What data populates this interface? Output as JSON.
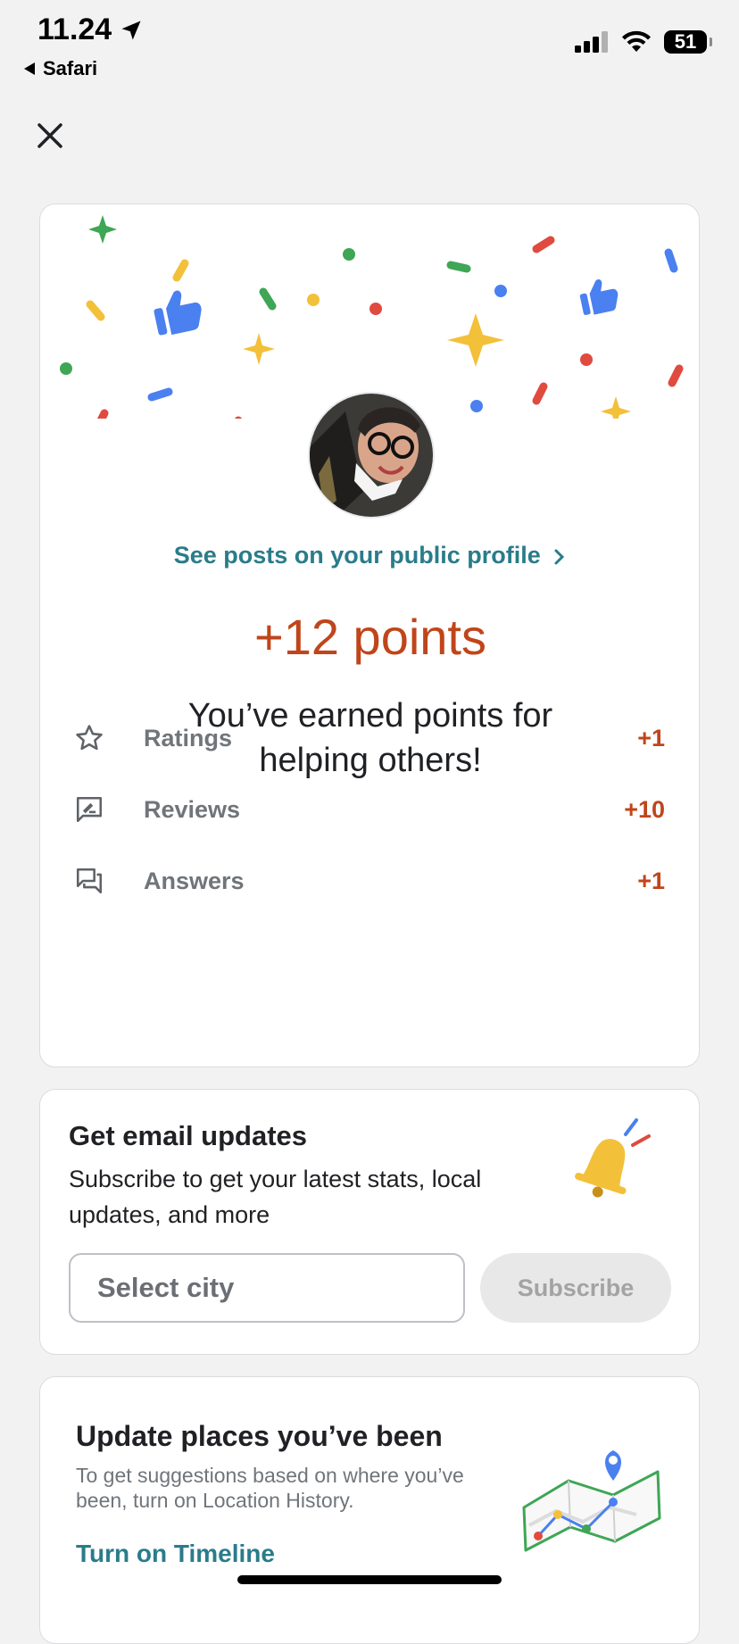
{
  "status_bar": {
    "time": "11.24",
    "back_label": "Safari",
    "battery": "51"
  },
  "points_card": {
    "profile_link": "See posts on your public profile",
    "points_total": "+12 points",
    "earned_message": "You’ve earned points for helping others!",
    "breakdown": [
      {
        "icon": "star-icon",
        "label": "Ratings",
        "points": "+1"
      },
      {
        "icon": "review-icon",
        "label": "Reviews",
        "points": "+10"
      },
      {
        "icon": "answers-icon",
        "label": "Answers",
        "points": "+1"
      }
    ]
  },
  "email_card": {
    "title": "Get email updates",
    "description": "Subscribe to get your latest stats, local updates, and more",
    "city_placeholder": "Select city",
    "subscribe_label": "Subscribe"
  },
  "places_card": {
    "title": "Update places you’ve been",
    "description": "To get suggestions based on where you’ve been, turn on Location History.",
    "link": "Turn on Timeline"
  },
  "colors": {
    "accent_teal": "#2a7c8a",
    "points_orange": "#c0451a",
    "google_blue": "#4a80f0",
    "google_red": "#e04a3f",
    "google_yellow": "#f3c03a",
    "google_green": "#3ea655"
  }
}
